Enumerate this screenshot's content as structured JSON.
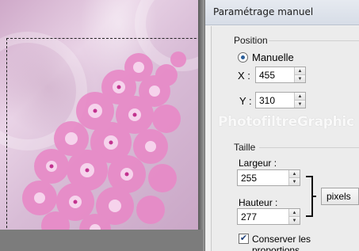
{
  "dialog": {
    "title": "Paramétrage manuel",
    "watermark": "PhotofiltreGraphic"
  },
  "position": {
    "group_label": "Position",
    "mode_label": "Manuelle",
    "x_label": "X :",
    "x_value": "455",
    "y_label": "Y :",
    "y_value": "310"
  },
  "size": {
    "group_label": "Taille",
    "width_label": "Largeur :",
    "width_value": "255",
    "height_label": "Hauteur :",
    "height_value": "277",
    "unit_selected": "pixels",
    "keep_ratio_label": "Conserver les proportions",
    "keep_ratio_checked": true
  },
  "icons": {
    "spin_up": "spin-up-icon",
    "spin_down": "spin-down-icon",
    "check": "checkmark-icon"
  }
}
